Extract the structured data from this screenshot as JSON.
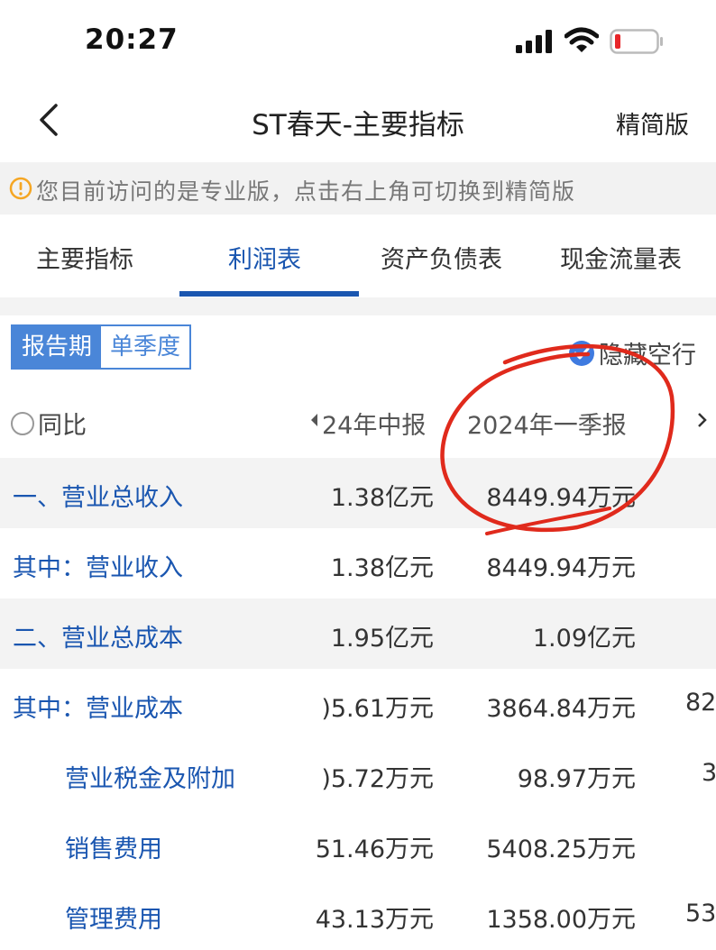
{
  "status": {
    "time": "20:27"
  },
  "nav": {
    "title": "ST春天-主要指标",
    "simple_label": "精简版"
  },
  "notice": {
    "text": "您目前访问的是专业版，点击右上角可切换到精简版"
  },
  "tabs": [
    {
      "label": "主要指标"
    },
    {
      "label": "利润表"
    },
    {
      "label": "资产负债表"
    },
    {
      "label": "现金流量表"
    }
  ],
  "active_tab": "利润表",
  "filter": {
    "seg_report": "报告期",
    "seg_quarter": "单季度",
    "hide_empty": "隐藏空行"
  },
  "header": {
    "yoy": "同比",
    "col1": "24年中报",
    "col2": "2024年一季报"
  },
  "rows": [
    {
      "label": "一、营业总收入",
      "v1": "1.38亿元",
      "v2": "8449.94万元",
      "v3": ""
    },
    {
      "label": "其中：营业收入",
      "v1": "1.38亿元",
      "v2": "8449.94万元",
      "v3": ""
    },
    {
      "label": "二、营业总成本",
      "v1": "1.95亿元",
      "v2": "1.09亿元",
      "v3": ""
    },
    {
      "label": "其中：营业成本",
      "v1": ")5.61万元",
      "v2": "3864.84万元",
      "v3": "82"
    },
    {
      "label": "营业税金及附加",
      "v1": ")5.72万元",
      "v2": "98.97万元",
      "v3": "3"
    },
    {
      "label": "销售费用",
      "v1": "51.46万元",
      "v2": "5408.25万元",
      "v3": ""
    },
    {
      "label": "管理费用",
      "v1": "43.13万元",
      "v2": "1358.00万元",
      "v3": "53"
    }
  ],
  "colors": {
    "accent": "#1a56b0",
    "annotation": "#e02a1c"
  }
}
